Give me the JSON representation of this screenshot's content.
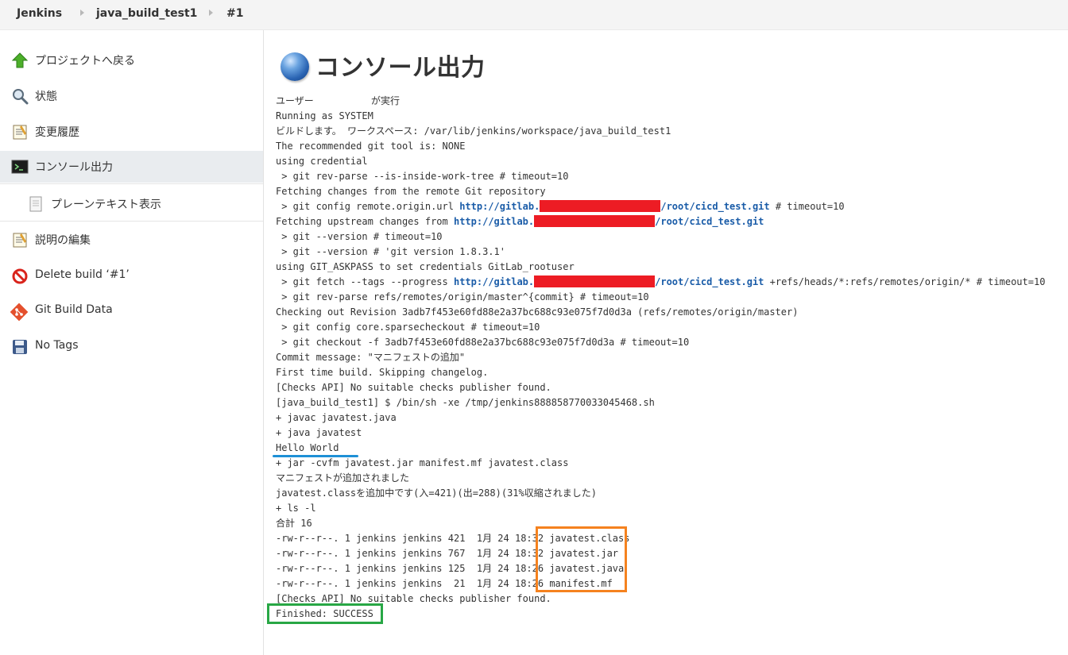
{
  "breadcrumb": {
    "items": [
      "Jenkins",
      "java_build_test1",
      "#1"
    ]
  },
  "sidebar": {
    "items": [
      {
        "label": "プロジェクトへ戻る",
        "icon": "up-arrow-icon"
      },
      {
        "label": "状態",
        "icon": "magnifier-icon"
      },
      {
        "label": "変更履歴",
        "icon": "notepad-icon"
      },
      {
        "label": "コンソール出力",
        "icon": "terminal-icon",
        "active": true
      },
      {
        "label": "プレーンテキスト表示",
        "icon": "document-icon"
      },
      {
        "label": "説明の編集",
        "icon": "notepad-icon"
      },
      {
        "label": "Delete build ‘#1’",
        "icon": "no-entry-icon"
      },
      {
        "label": "Git Build Data",
        "icon": "git-icon"
      },
      {
        "label": "No Tags",
        "icon": "save-icon"
      }
    ]
  },
  "page": {
    "title": "コンソール出力"
  },
  "console": {
    "lines": [
      [
        "ユーザー          が実行"
      ],
      [
        "Running as SYSTEM"
      ],
      [
        "ビルドします。 ワークスペース: /var/lib/jenkins/workspace/java_build_test1"
      ],
      [
        "The recommended git tool is: NONE"
      ],
      [
        "using credential"
      ],
      [
        " > git rev-parse --is-inside-work-tree # timeout=10"
      ],
      [
        "Fetching changes from the remote Git repository"
      ],
      [
        " > git config remote.origin.url ",
        "http://gitlab.",
        "",
        "/root/cicd_test.git",
        " # timeout=10"
      ],
      [
        "Fetching upstream changes from ",
        "http://gitlab.",
        "",
        "/root/cicd_test.git"
      ],
      [
        " > git --version # timeout=10"
      ],
      [
        " > git --version # 'git version 1.8.3.1'"
      ],
      [
        "using GIT_ASKPASS to set credentials GitLab_rootuser"
      ],
      [
        " > git fetch --tags --progress ",
        "http://gitlab.",
        "",
        "/root/cicd_test.git",
        " +refs/heads/*:refs/remotes/origin/* # timeout=10"
      ],
      [
        " > git rev-parse refs/remotes/origin/master^{commit} # timeout=10"
      ],
      [
        "Checking out Revision 3adb7f453e60fd88e2a37bc688c93e075f7d0d3a (refs/remotes/origin/master)"
      ],
      [
        " > git config core.sparsecheckout # timeout=10"
      ],
      [
        " > git checkout -f 3adb7f453e60fd88e2a37bc688c93e075f7d0d3a # timeout=10"
      ],
      [
        "Commit message: \"マニフェストの追加\""
      ],
      [
        "First time build. Skipping changelog."
      ],
      [
        "[Checks API] No suitable checks publisher found."
      ],
      [
        "[java_build_test1] $ /bin/sh -xe /tmp/jenkins8888587700330454​68.sh"
      ],
      [
        "+ javac javatest.java"
      ],
      [
        "+ java javatest"
      ],
      [
        "Hello World"
      ],
      [
        "+ jar -cvfm javatest.jar manifest.mf javatest.class"
      ],
      [
        "マニフェストが追加されました"
      ],
      [
        "javatest.classを追加中です(入=421)(出=288)(31%収縮されました)"
      ],
      [
        "+ ls -l"
      ],
      [
        "合計 16"
      ],
      [
        "-rw-r--r--. 1 jenkins jenkins 421  1月 24 18:32 javatest.class"
      ],
      [
        "-rw-r--r--. 1 jenkins jenkins 767  1月 24 18:32 javatest.jar"
      ],
      [
        "-rw-r--r--. 1 jenkins jenkins 125  1月 24 18:26 javatest.java"
      ],
      [
        "-rw-r--r--. 1 jenkins jenkins  21  1月 24 18:26 manifest.mf"
      ],
      [
        "[Checks API] No suitable checks publisher found."
      ],
      [
        "Finished: SUCCESS"
      ]
    ]
  },
  "colors": {
    "redaction": "#ed1c24",
    "link": "#1a5ca8",
    "hello_underline": "#1e90d6",
    "file_box": "#f5821f",
    "success_box": "#28a745"
  }
}
